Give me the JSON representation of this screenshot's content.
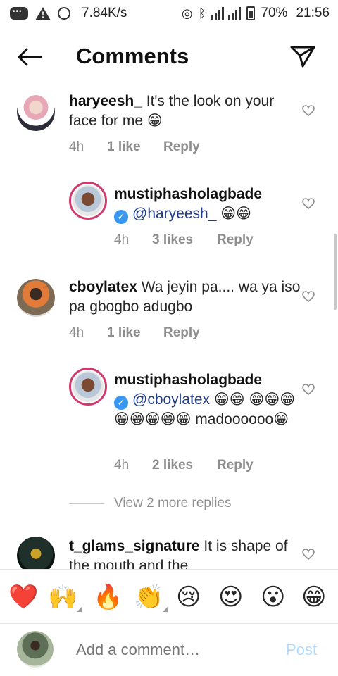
{
  "status_bar": {
    "speed": "7.84K/s",
    "battery": "70%",
    "time": "21:56"
  },
  "header": {
    "title": "Comments"
  },
  "comments": [
    {
      "username": "haryeesh_",
      "text": " It's the look on your face for me 😁",
      "time": "4h",
      "likes": "1 like",
      "reply": "Reply"
    },
    {
      "username": "mustiphasholagbade",
      "mention": "@haryeesh_",
      "text": " 😁😁",
      "time": "4h",
      "likes": "3 likes",
      "reply": "Reply"
    },
    {
      "username": "cboylatex",
      "text": " Wa jeyin pa.... wa ya iso pa gbogbo adugbo",
      "time": "4h",
      "likes": "1 like",
      "reply": "Reply"
    },
    {
      "username": "mustiphasholagbade",
      "mention": "@cboylatex",
      "text": " 😁😁 😁😁😁😁😁😁😁😁 madoooooo😁",
      "time": "4h",
      "likes": "2 likes",
      "reply": "Reply"
    },
    {
      "username": "t_glams_signature",
      "text": " It is shape of the mouth and the"
    }
  ],
  "view_more": "View 2 more replies",
  "emoji_bar": [
    "❤️",
    "🙌",
    "🔥",
    "👏",
    "😢",
    "😍",
    "😮",
    "😁"
  ],
  "composer": {
    "placeholder": "Add a comment…",
    "post_label": "Post"
  },
  "colors": {
    "accent_blue": "#3897f0",
    "post_disabled": "#b3dbff",
    "meta_gray": "#8e8e8e",
    "story_ring": "#d23a6e"
  }
}
